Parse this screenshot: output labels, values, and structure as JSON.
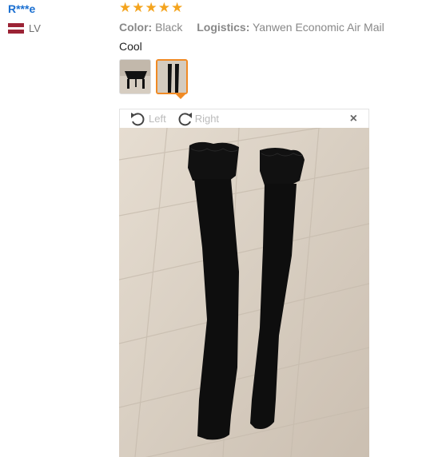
{
  "reviewer": {
    "name": "R***e",
    "country": "LV"
  },
  "review": {
    "rating": 5,
    "stars": [
      "★",
      "★",
      "★",
      "★",
      "★"
    ],
    "color_label": "Color:",
    "color_value": "Black",
    "logistics_label": "Logistics:",
    "logistics_value": "Yanwen Economic Air Mail",
    "text": "Cool"
  },
  "viewer": {
    "rotate_left_label": "Left",
    "rotate_right_label": "Right",
    "close_label": "×"
  },
  "colors": {
    "star": "#f4a41e",
    "accent": "#f08a24",
    "link": "#1a6fd1"
  }
}
